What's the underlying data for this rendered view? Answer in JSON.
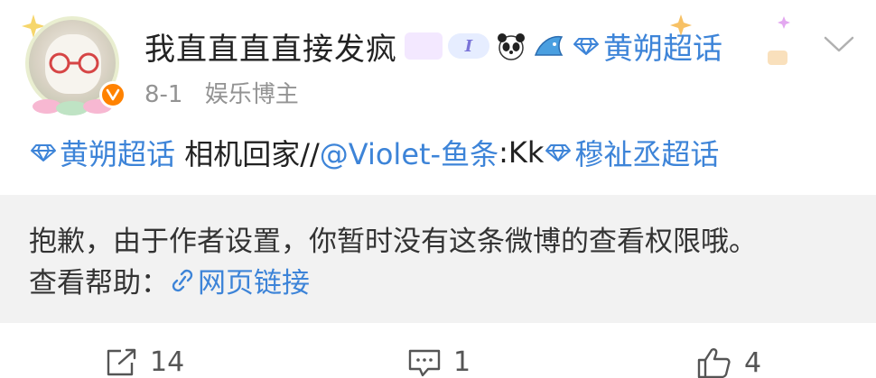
{
  "post": {
    "author": {
      "name": "我直直直直接发疯",
      "date": "8-1",
      "role": "娱乐博主"
    },
    "header_topic": "黄朔超话",
    "badge_i_text": "I",
    "body": {
      "topic_1": "黄朔超话",
      "text_1": " 相机回家//",
      "mention": "@Violet-鱼条",
      "text_2": ":Kk",
      "topic_2": "穆祉丞超话"
    },
    "restricted": {
      "message": "抱歉，由于作者设置，你暂时没有这条微博的查看权限哦。",
      "help_label": "查看帮助：",
      "help_link": "网页链接"
    },
    "actions": {
      "repost_count": "14",
      "comment_count": "1",
      "like_count": "4"
    }
  },
  "icons": {
    "verified": "verified-badge-icon",
    "menu": "chevron-down-icon",
    "supertopic": "diamond-icon",
    "link": "link-icon",
    "repost": "repost-icon",
    "comment": "comment-icon",
    "like": "thumbs-up-icon"
  },
  "colors": {
    "link_blue": "#3d84d8",
    "verified_orange": "#ff8200",
    "restricted_bg": "#f2f2f2",
    "meta_gray": "#939393"
  }
}
